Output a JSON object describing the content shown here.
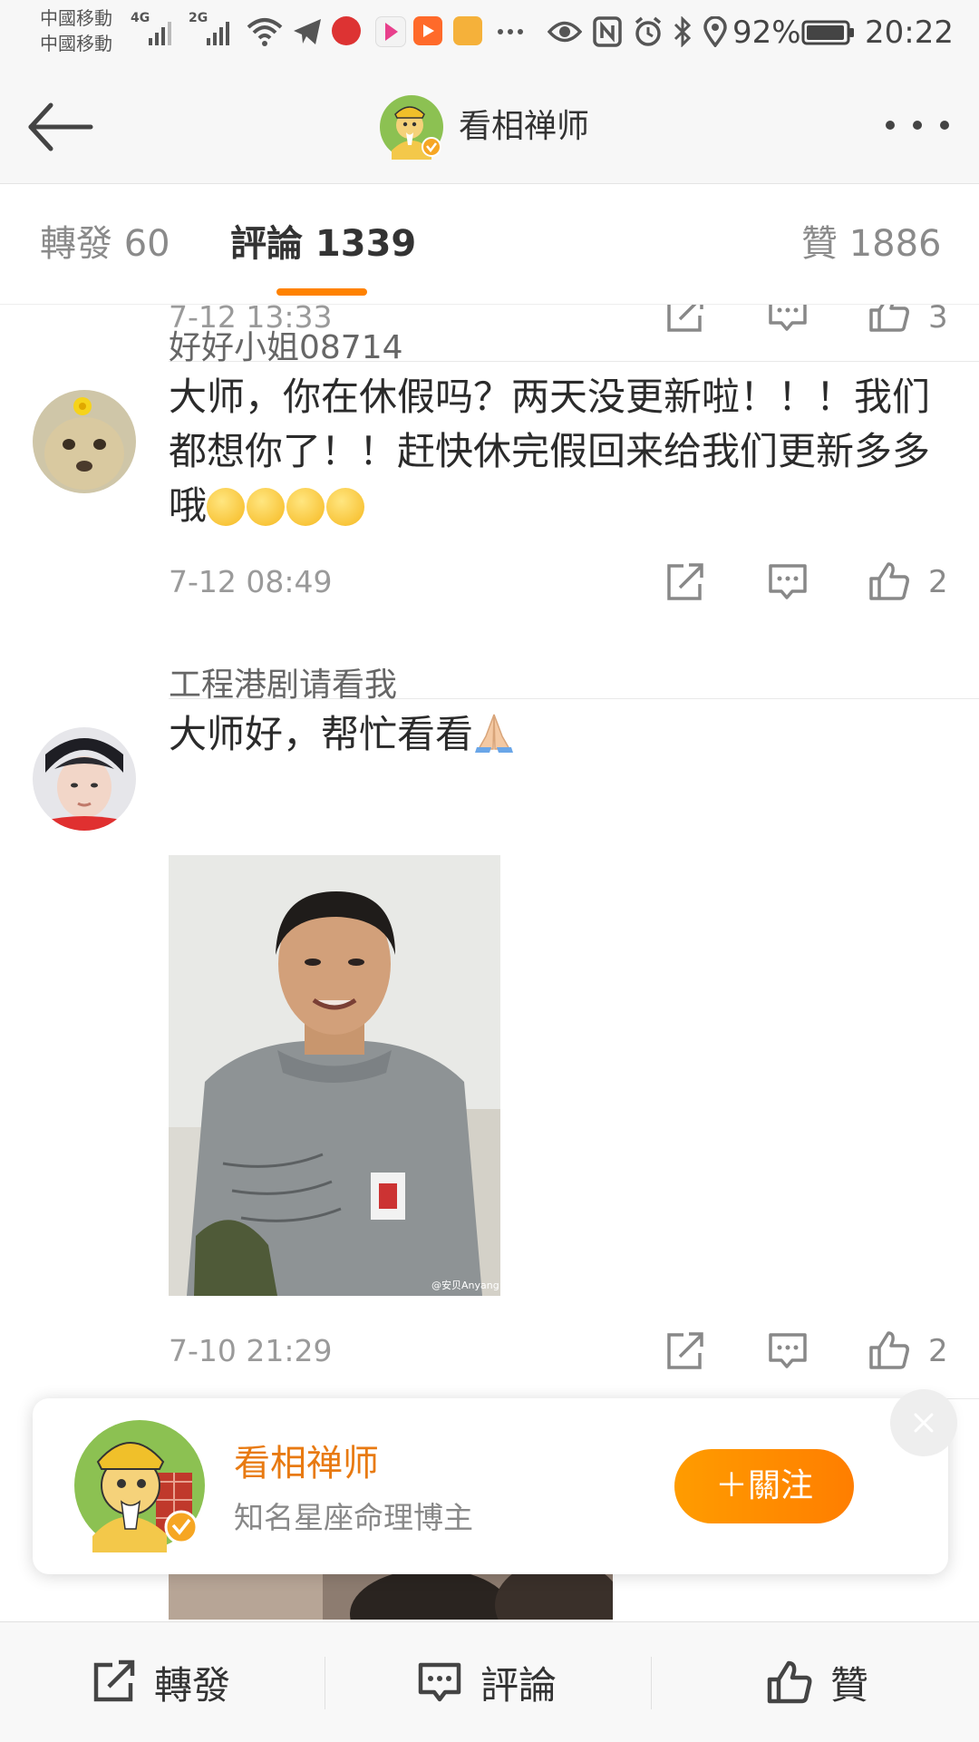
{
  "status_bar": {
    "carrier_1": "中國移動",
    "carrier_2": "中國移動",
    "net_1": "4G",
    "net_2": "2G",
    "battery": "92%",
    "time": "20:22",
    "app_icons": [
      "telegram-icon",
      "cmb-icon",
      "youku-icon",
      "video-icon",
      "reader-icon"
    ],
    "system_icons": [
      "eye-icon",
      "nfc-icon",
      "alarm-icon",
      "bluetooth-icon",
      "location-icon",
      "battery-icon"
    ]
  },
  "nav": {
    "title": "看相禅师",
    "back_icon": "back-arrow-icon",
    "more_icon": "more-dots-icon"
  },
  "tabs": {
    "reposts": "轉發 60",
    "comments": "評論 1339",
    "likes": "贊 1886",
    "active": "comments",
    "accent": "#ff8200"
  },
  "comments": [
    {
      "time": "7-12 13:33",
      "likes": "3"
    },
    {
      "username": "好好小姐08714",
      "text": "大师，你在休假吗？两天没更新啦！！！我们都想你了！！赶快休完假回来给我们更新多多哦",
      "emoji_count": 4,
      "time": "7-12 08:49",
      "likes": "2"
    },
    {
      "username": "工程港剧请看我",
      "text": "大师好，帮忙看看",
      "emoji": "folded-hands",
      "image_watermark": "@安贝Anyang",
      "time": "7-10 21:29",
      "likes": "2"
    }
  ],
  "follow_card": {
    "name": "看相禅师",
    "description": "知名星座命理博主",
    "follow_label": "＋關注",
    "name_color": "#e87a12",
    "button_color": "#ff8a00"
  },
  "bottom_bar": {
    "repost": "轉發",
    "comment": "評論",
    "like": "贊"
  }
}
